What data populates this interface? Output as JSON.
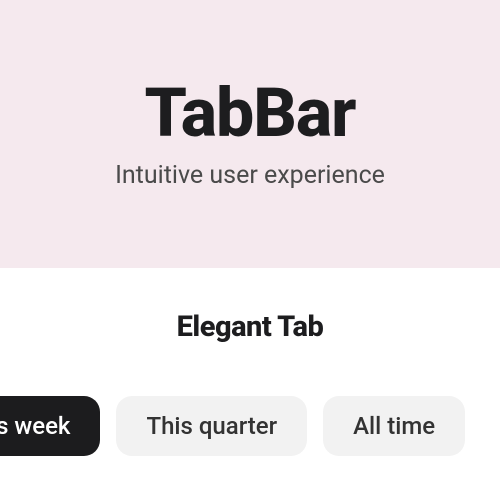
{
  "hero": {
    "title": "TabBar",
    "subtitle": "Intuitive user experience"
  },
  "section": {
    "title": "Elegant Tab"
  },
  "tabs": {
    "items": [
      {
        "label": "This week",
        "active": true
      },
      {
        "label": "This quarter",
        "active": false
      },
      {
        "label": "All time",
        "active": false
      }
    ]
  }
}
